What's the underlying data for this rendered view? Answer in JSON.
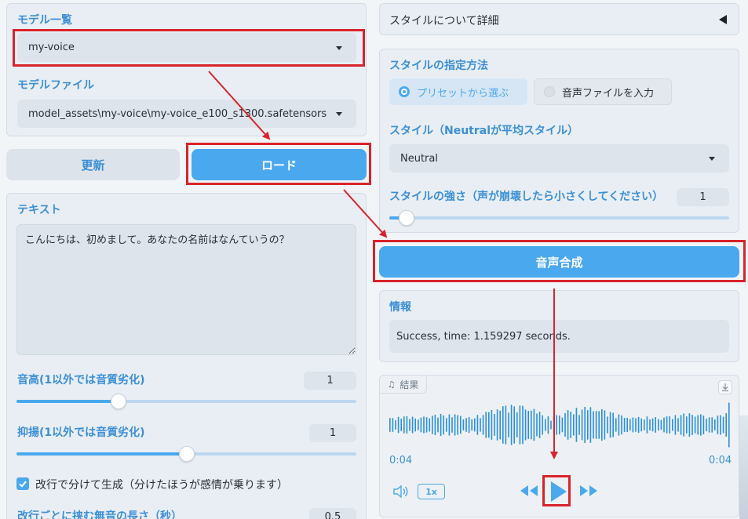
{
  "left": {
    "model_list_label": "モデル一覧",
    "model_selected": "my-voice",
    "model_file_label": "モデルファイル",
    "model_file_selected": "model_assets\\my-voice\\my-voice_e100_s1300.safetensors",
    "refresh_button": "更新",
    "load_button": "ロード",
    "text_label": "テキスト",
    "text_value": "こんにちは、初めまして。あなたの名前はなんていうの？",
    "pitch_label": "音高(1以外では音質劣化)",
    "pitch_value": "1",
    "pitch_level": 0.3,
    "intonation_label": "抑揚(1以外では音質劣化)",
    "intonation_value": "1",
    "intonation_level": 0.5,
    "split_checkbox_label": "改行で分けて生成（分けたほうが感情が乗ります）",
    "split_checked": true,
    "silence_label": "改行ごとに挟む無音の長さ（秒）",
    "silence_value": "0.5"
  },
  "right": {
    "style_detail_label": "スタイルについて詳細",
    "style_method_label": "スタイルの指定方法",
    "option_preset": "プリセットから選ぶ",
    "option_audio": "音声ファイルを入力",
    "style_label": "スタイル（Neutralが平均スタイル）",
    "style_selected": "Neutral",
    "style_strength_label": "スタイルの強さ（声が崩壊したら小さくしてください）",
    "style_strength_value": "1",
    "style_strength_level": 0.05,
    "synthesize_button": "音声合成",
    "info_label": "情報",
    "info_value": "Success, time: 1.159297 seconds.",
    "result_label": "結果",
    "time_current": "0:04",
    "time_total": "0:04",
    "speed_label": "1x"
  },
  "colors": {
    "accent": "#4aa8ef",
    "label_blue": "#3b8fd6",
    "highlight_red": "#d9232a"
  }
}
